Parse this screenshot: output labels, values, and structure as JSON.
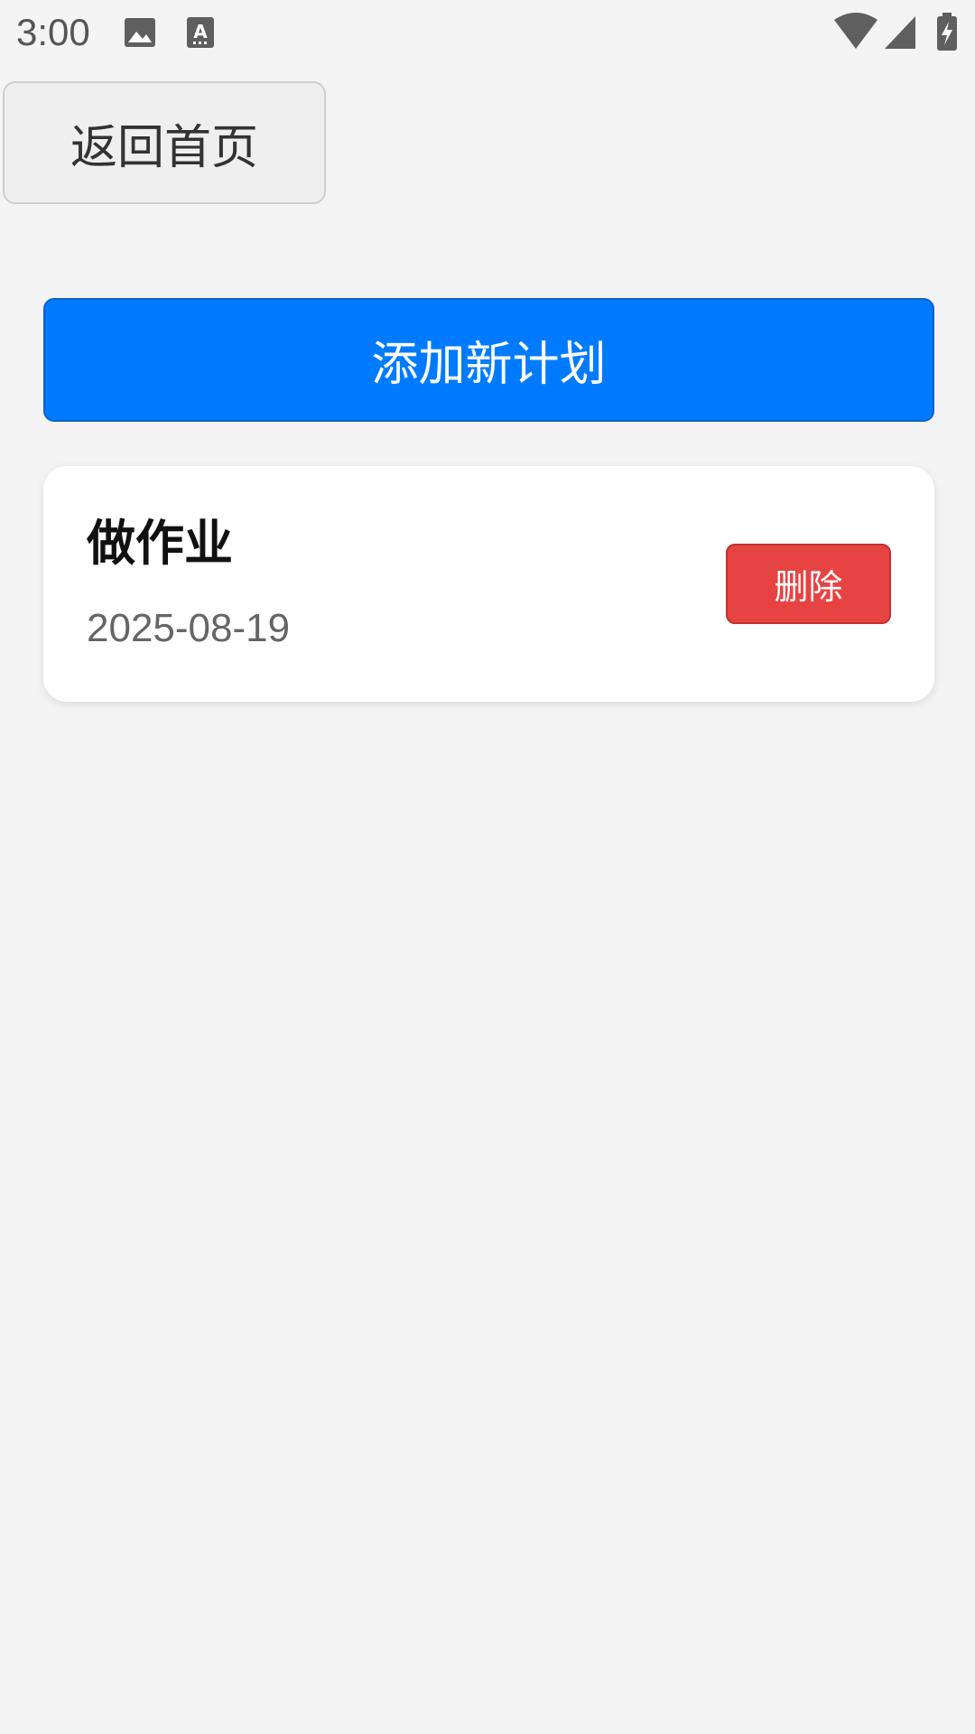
{
  "status_bar": {
    "time": "3:00",
    "left_icons": [
      "image-icon",
      "text-icon"
    ],
    "right_icons": [
      "wifi-icon",
      "cell-signal-icon",
      "battery-charging-icon"
    ]
  },
  "back_button": {
    "label": "返回首页"
  },
  "add_button": {
    "label": "添加新计划",
    "color": "#007bff"
  },
  "plans": [
    {
      "title": "做作业",
      "date": "2025-08-19",
      "delete_label": "删除",
      "delete_color": "#e74343"
    }
  ]
}
